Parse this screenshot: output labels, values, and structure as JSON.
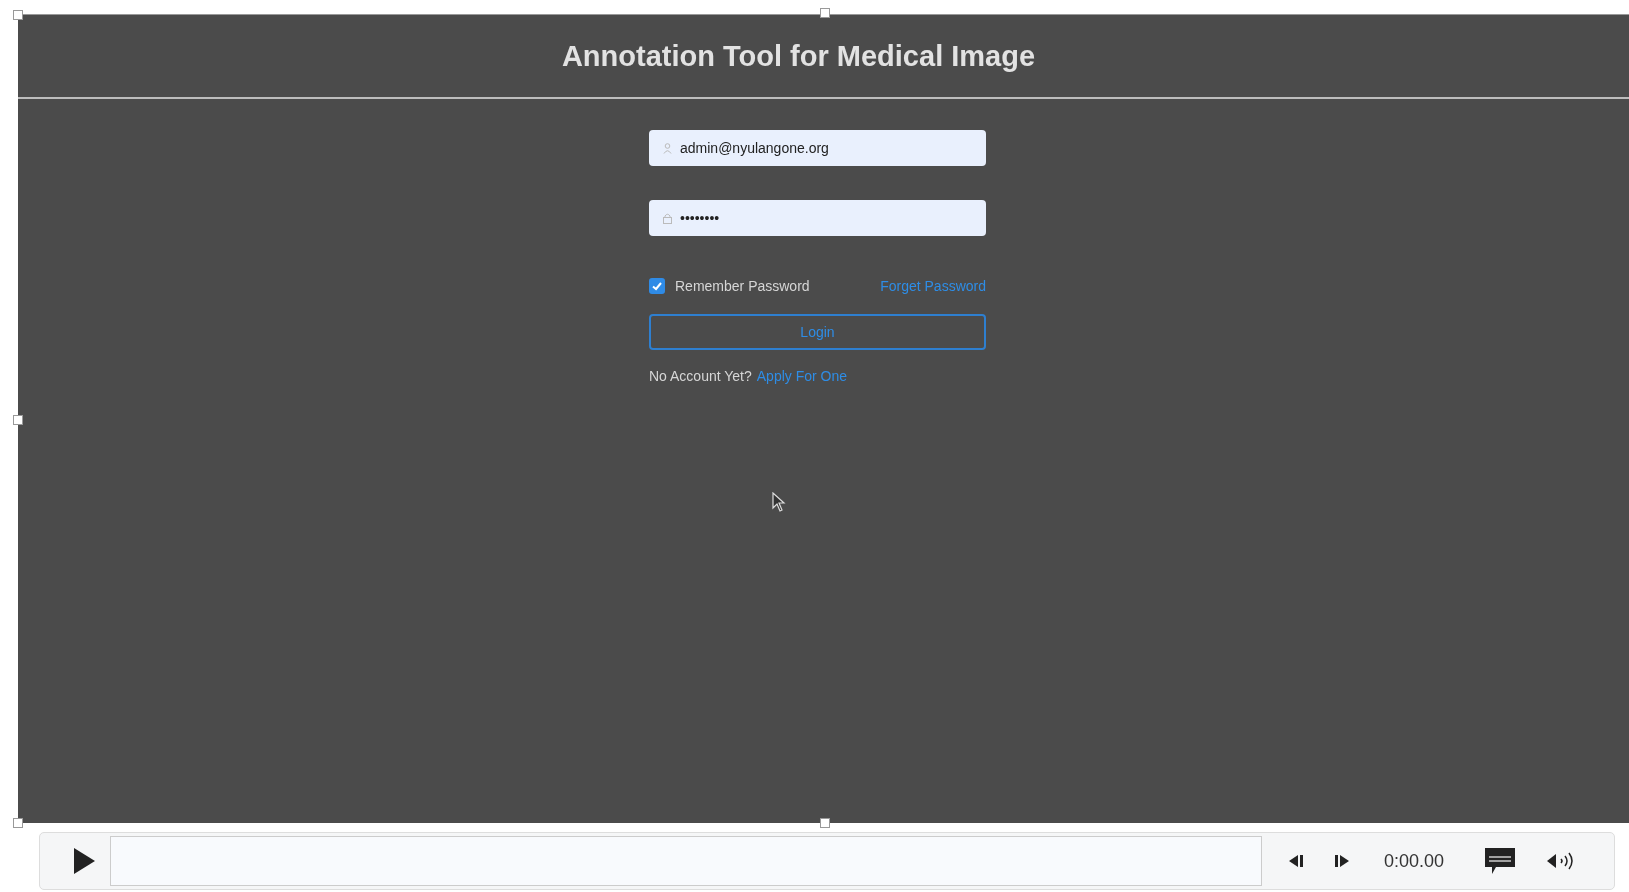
{
  "page": {
    "title": "Annotation Tool for Medical Image"
  },
  "login": {
    "email": {
      "value": "admin@nyulangone.org"
    },
    "password": {
      "value": "••••••••"
    },
    "remember": {
      "label": "Remember Password",
      "checked": true
    },
    "forgot_link": "Forget Password",
    "login_button": "Login",
    "no_account": "No Account Yet?",
    "apply_link": "Apply For One"
  },
  "player": {
    "time": "0:00.00"
  }
}
